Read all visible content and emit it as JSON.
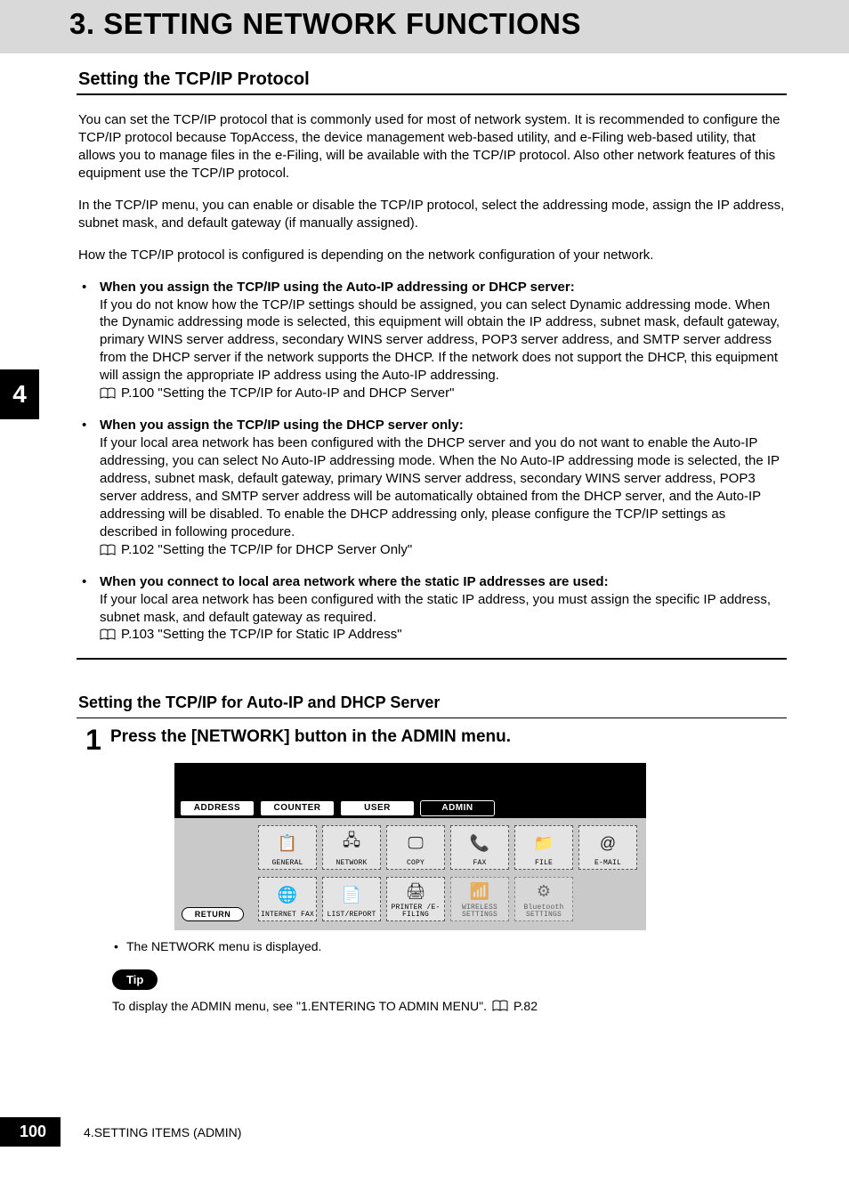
{
  "chapter": {
    "title": "3. SETTING NETWORK FUNCTIONS"
  },
  "section1": {
    "heading": "Setting the TCP/IP Protocol",
    "p1": "You can set the TCP/IP protocol that is commonly used for most of network system.  It is recommended to configure the TCP/IP protocol because TopAccess, the device management web-based utility, and e-Filing web-based utility, that allows you to manage files in the e-Filing, will be available with the TCP/IP protocol. Also other network features of this equipment use the TCP/IP protocol.",
    "p2": "In the TCP/IP menu, you can enable or disable the TCP/IP protocol, select the addressing mode, assign the IP address, subnet mask, and default gateway (if manually assigned).",
    "p3": "How the TCP/IP protocol is configured is depending on the network configuration of your network.",
    "bullets": [
      {
        "title": "When you assign the TCP/IP using the Auto-IP addressing or DHCP server:",
        "body": "If you do not know how the TCP/IP settings should be assigned, you can select Dynamic addressing mode.  When the Dynamic addressing mode is selected, this equipment will obtain the IP address, subnet mask, default gateway, primary WINS server address, secondary WINS server address, POP3 server address, and SMTP server address from the DHCP server if the network supports the DHCP.  If the network does not support the DHCP, this equipment will assign the appropriate IP address using the Auto-IP addressing.",
        "ref": "P.100 \"Setting the TCP/IP for Auto-IP and DHCP Server\""
      },
      {
        "title": "When you assign the TCP/IP using the DHCP server only:",
        "body": "If your local area network has been configured with the DHCP server and you do not want to enable the Auto-IP addressing, you can select No Auto-IP addressing mode.  When the No Auto-IP addressing mode is selected, the IP address, subnet mask, default gateway, primary WINS server address, secondary WINS server address, POP3 server address, and SMTP server address will be automatically obtained from the DHCP server, and the Auto-IP addressing will be disabled.  To enable the DHCP addressing only, please configure the TCP/IP settings as described in following procedure.",
        "ref": "P.102 \"Setting the TCP/IP for DHCP Server Only\""
      },
      {
        "title": "When you connect to local area network where the static IP addresses are used:",
        "body": "If your local area network has been configured with the static IP address, you must assign the specific IP address, subnet mask, and default gateway as required.",
        "ref": "P.103 \"Setting the TCP/IP for Static IP Address\""
      }
    ]
  },
  "section2": {
    "heading": "Setting the TCP/IP for Auto-IP and DHCP Server",
    "step_num": "1",
    "step_title": "Press the [NETWORK] button in the ADMIN menu.",
    "screen": {
      "tabs": [
        "ADDRESS",
        "COUNTER",
        "USER",
        "ADMIN"
      ],
      "row1": [
        {
          "label": "GENERAL",
          "glyph": "📋"
        },
        {
          "label": "NETWORK",
          "glyph": "🖧"
        },
        {
          "label": "COPY",
          "glyph": "🖵"
        },
        {
          "label": "FAX",
          "glyph": "📞"
        },
        {
          "label": "FILE",
          "glyph": "📁"
        },
        {
          "label": "E-MAIL",
          "glyph": "@"
        }
      ],
      "row2": [
        {
          "label": "INTERNET FAX",
          "glyph": "🌐"
        },
        {
          "label": "LIST/REPORT",
          "glyph": "📄"
        },
        {
          "label": "PRINTER /E-FILING",
          "glyph": "🖨"
        },
        {
          "label": "WIRELESS SETTINGS",
          "glyph": "📶",
          "dim": true
        },
        {
          "label": "Bluetooth SETTINGS",
          "glyph": "⚙",
          "dim": true
        }
      ],
      "return_label": "RETURN"
    },
    "after_bullet": "The NETWORK menu is displayed.",
    "tip_label": "Tip",
    "tip_text": "To display the ADMIN menu, see \"1.ENTERING TO ADMIN MENU\".",
    "tip_ref": "P.82"
  },
  "side_chapter": "4",
  "footer": {
    "page": "100",
    "text": "4.SETTING ITEMS (ADMIN)"
  }
}
